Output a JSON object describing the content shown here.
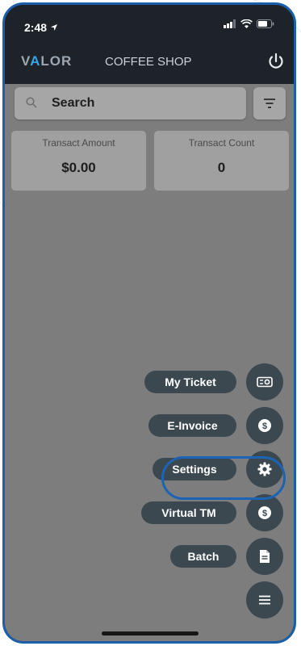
{
  "status": {
    "time": "2:48"
  },
  "header": {
    "logo": "VALOR",
    "logo_highlight": "A",
    "title": "COFFEE SHOP"
  },
  "search": {
    "label": "Search"
  },
  "stats": [
    {
      "label": "Transact Amount",
      "value": "$0.00"
    },
    {
      "label": "Transact Count",
      "value": "0"
    }
  ],
  "fab_menu": [
    {
      "label": "My Ticket",
      "icon": "ticket-icon"
    },
    {
      "label": "E-Invoice",
      "icon": "dollar-coin-icon"
    },
    {
      "label": "Settings",
      "icon": "gear-icon"
    },
    {
      "label": "Virtual TM",
      "icon": "dollar-coin-icon"
    },
    {
      "label": "Batch",
      "icon": "document-icon"
    }
  ],
  "colors": {
    "frame": "#1b5fa8",
    "highlight": "#1c63b5",
    "dark": "#1d2329",
    "fab": "#3c4850"
  }
}
